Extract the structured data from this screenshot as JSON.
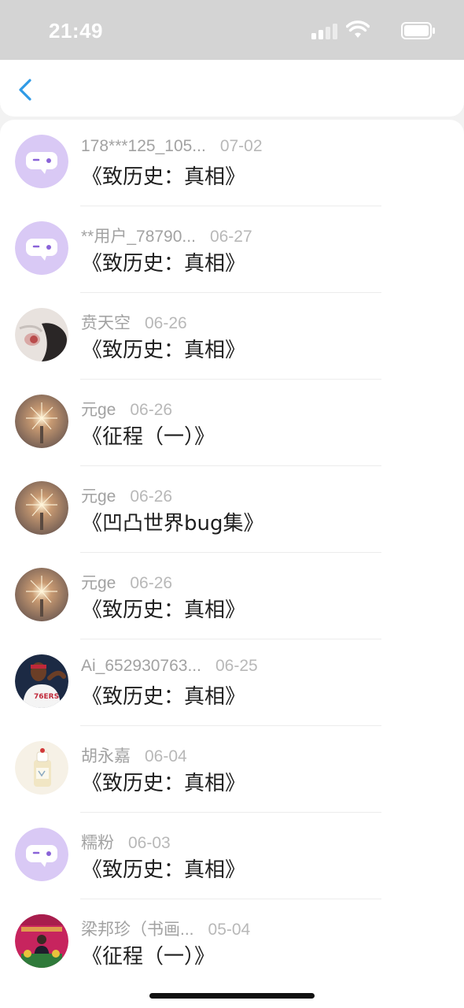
{
  "status_bar": {
    "time": "21:49"
  },
  "nav": {
    "back_icon": "chevron-left-icon"
  },
  "items": [
    {
      "user": "178***125_105...",
      "date": "07-02",
      "title": "《致历史：真相》",
      "avatar": "chat-bubble-icon"
    },
    {
      "user": "**用户_78790...",
      "date": "06-27",
      "title": "《致历史：真相》",
      "avatar": "chat-bubble-icon"
    },
    {
      "user": "贲天空",
      "date": "06-26",
      "title": "《致历史：真相》",
      "avatar": "user-photo"
    },
    {
      "user": "元ge",
      "date": "06-26",
      "title": "《征程（一）》",
      "avatar": "sparkler-photo"
    },
    {
      "user": "元ge",
      "date": "06-26",
      "title": "《凹凸世界bug集》",
      "avatar": "sparkler-photo"
    },
    {
      "user": "元ge",
      "date": "06-26",
      "title": "《致历史：真相》",
      "avatar": "sparkler-photo"
    },
    {
      "user": "Ai_652930763...",
      "date": "06-25",
      "title": "《致历史：真相》",
      "avatar": "basketball-player-photo"
    },
    {
      "user": "胡永嘉",
      "date": "06-04",
      "title": "《致历史：真相》",
      "avatar": "bottle-photo"
    },
    {
      "user": "糯粉",
      "date": "06-03",
      "title": "《致历史：真相》",
      "avatar": "chat-bubble-icon"
    },
    {
      "user": "梁邦珍（书画...",
      "date": "05-04",
      "title": "《征程（一）》",
      "avatar": "stage-photo"
    }
  ],
  "colors": {
    "accent": "#2f9ae6",
    "default_avatar_bg": "#d9c9f5",
    "default_avatar_eye": "#8a63d8"
  }
}
